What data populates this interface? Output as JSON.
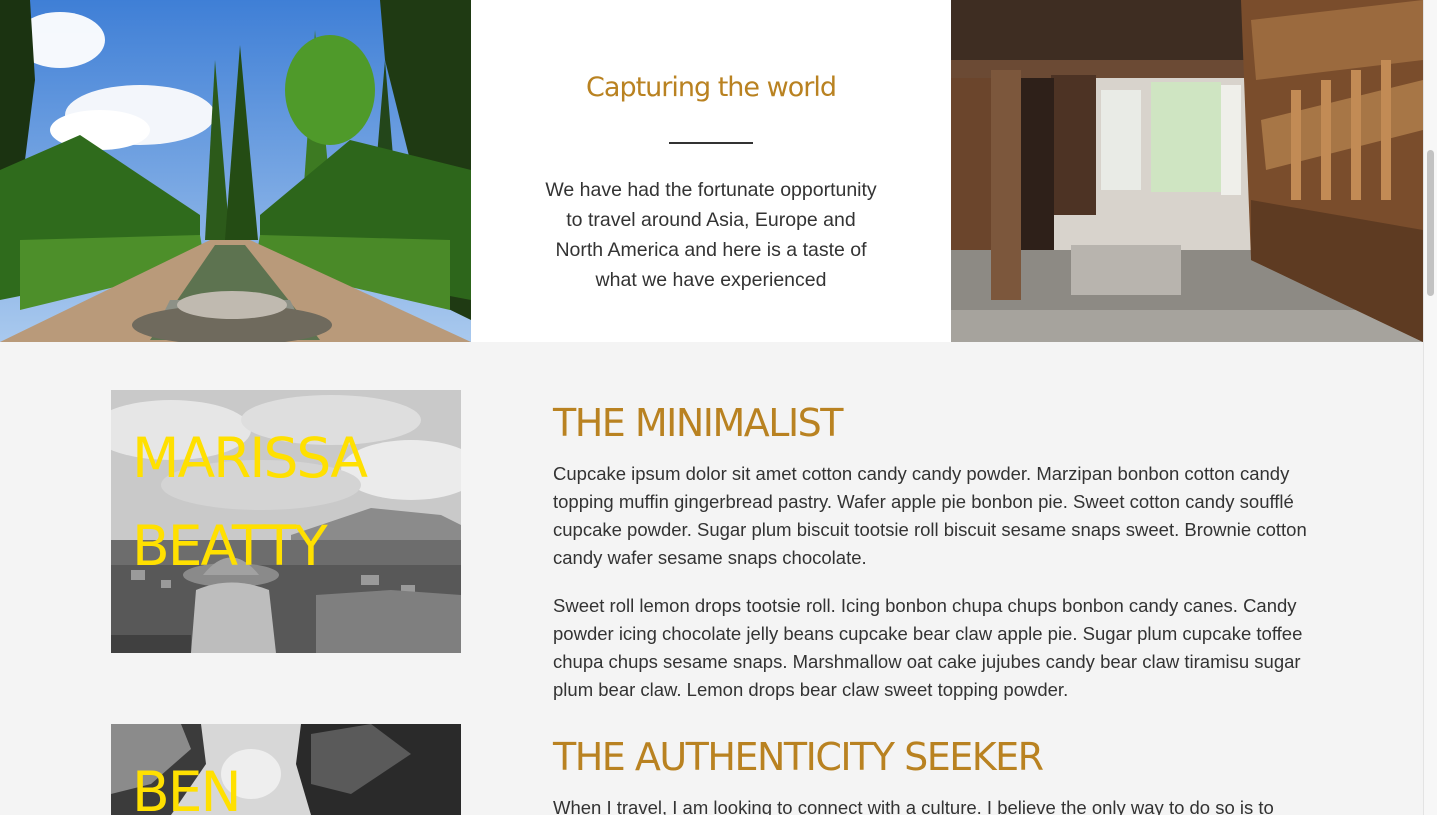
{
  "hero": {
    "title": "Capturing the world",
    "body": "We have had the fortunate opportunity to travel around Asia, Europe and North America and here is a taste of what we have experienced",
    "left_image": "garden-photo",
    "right_image": "temple-photo"
  },
  "colors": {
    "accent": "#b98221",
    "name_yellow": "#ffe000",
    "text": "#333333",
    "background": "#f4f4f4"
  },
  "profiles": [
    {
      "name_line1": "MARISSA",
      "name_line2": "BEATTY",
      "heading": "THE MINIMALIST",
      "paragraphs": [
        "Cupcake ipsum dolor sit amet cotton candy candy powder. Marzipan bonbon cotton candy topping muffin gingerbread pastry. Wafer apple pie bonbon pie. Sweet cotton candy soufflé cupcake powder. Sugar plum biscuit tootsie roll biscuit sesame snaps sweet. Brownie cotton candy wafer sesame snaps chocolate.",
        "Sweet roll lemon drops tootsie roll. Icing bonbon chupa chups bonbon candy canes. Candy powder icing chocolate jelly beans cupcake bear claw apple pie. Sugar plum cupcake toffee chupa chups sesame snaps. Marshmallow oat cake jujubes candy bear claw tiramisu sugar plum bear claw. Lemon drops bear claw sweet topping powder."
      ]
    },
    {
      "name_line1": "BEN",
      "heading": "THE AUTHENTICITY SEEKER",
      "paragraphs": [
        "When I travel, I am looking to connect with a culture. I believe the only way to do so is to"
      ]
    }
  ]
}
